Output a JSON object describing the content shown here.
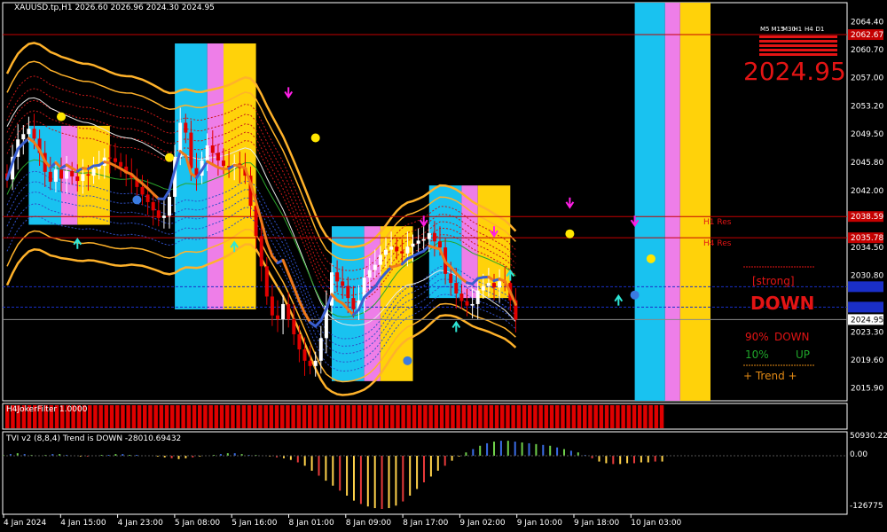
{
  "header": {
    "title": "XAUUSD.tp,H1  2026.60 2026.96 2024.30 2024.95"
  },
  "panels": {
    "filter_label": "H4JokerFilter 1.0000",
    "tvi_label": "TVI v2 (8,8,4) Trend is DOWN -28010.69432"
  },
  "price_panel": {
    "ylim": [
      2014.2,
      2066.9
    ],
    "ticks": [
      {
        "value": 2064.4,
        "label": "2064.40"
      },
      {
        "value": 2060.7,
        "label": "2060.70"
      },
      {
        "value": 2057.0,
        "label": "2057.00"
      },
      {
        "value": 2053.2,
        "label": "2053.20"
      },
      {
        "value": 2049.5,
        "label": "2049.50"
      },
      {
        "value": 2045.8,
        "label": "2045.80"
      },
      {
        "value": 2042.0,
        "label": "2042.00"
      },
      {
        "value": 2034.5,
        "label": "2034.50"
      },
      {
        "value": 2030.8,
        "label": "2030.80"
      },
      {
        "value": 2023.3,
        "label": "2023.30"
      },
      {
        "value": 2019.6,
        "label": "2019.60"
      },
      {
        "value": 2015.9,
        "label": "2015.90"
      }
    ],
    "price_boxes": [
      {
        "value": 2062.67,
        "label": "2062.67",
        "color": "#c40000"
      },
      {
        "value": 2038.59,
        "label": "2038.59",
        "color": "#c40000"
      },
      {
        "value": 2035.78,
        "label": "2035.78",
        "color": "#c40000"
      },
      {
        "value": 2029.3,
        "label": "",
        "color": "#1a2fc8"
      },
      {
        "value": 2026.6,
        "label": "",
        "color": "#1a2fc8"
      },
      {
        "value": 2024.95,
        "label": "2024.95",
        "color": "#ffffff"
      }
    ],
    "res_lines": [
      {
        "value": 2038.59,
        "label": "H1 Res"
      },
      {
        "value": 2035.78,
        "label": "H4 Res"
      }
    ]
  },
  "widget": {
    "timeframes": [
      "M5",
      "M15",
      "M30",
      "H1",
      "H4",
      "D1"
    ],
    "price": "2024.95",
    "signal_small": "[strong]",
    "signal": "DOWN",
    "down_pct": "90%",
    "down_label": "DOWN",
    "up_pct": "10%",
    "up_label": "UP",
    "trend_label": "+ Trend +"
  },
  "tvi_panel": {
    "ticks": [
      {
        "value": 50930.23,
        "label": "50930.229"
      },
      {
        "value": 0,
        "label": "0.00"
      },
      {
        "value": -126775,
        "label": "-126775"
      }
    ]
  },
  "time_axis": {
    "labels": [
      "4 Jan 2024",
      "4 Jan 15:00",
      "4 Jan 23:00",
      "5 Jan 08:00",
      "5 Jan 16:00",
      "8 Jan 01:00",
      "8 Jan 09:00",
      "8 Jan 17:00",
      "9 Jan 02:00",
      "9 Jan 10:00",
      "9 Jan 18:00",
      "10 Jan 03:00"
    ]
  },
  "colors": {
    "background": "#000000",
    "bull_candle": "#ffffff",
    "bear_candle": "#e00000",
    "zone_cyan": "#19c2f0",
    "zone_magenta": "#ee7ee8",
    "zone_yellow": "#ffd20a",
    "trend_blue": "#3a5fd0",
    "trend_orange": "#f07a1a",
    "band_orange": "#ffb22a"
  },
  "chart_data": {
    "type": "candlestick",
    "symbol": "XAUUSD.tp",
    "timeframe": "H1",
    "last": {
      "open": 2026.6,
      "high": 2026.96,
      "low": 2024.3,
      "close": 2024.95
    },
    "close_series": [
      2043.5,
      2046.5,
      2048.8,
      2049.5,
      2050.2,
      2048.9,
      2047.0,
      2044.5,
      2043.2,
      2044.8,
      2043.6,
      2044.6,
      2043.9,
      2043.3,
      2044.2,
      2044.0,
      2044.9,
      2045.3,
      2046.4,
      2046.3,
      2045.8,
      2045.2,
      2044.3,
      2043.7,
      2042.5,
      2041.5,
      2040.5,
      2039.4,
      2038.4,
      2038.7,
      2041.2,
      2046.5,
      2051.0,
      2049.7,
      2045.0,
      2044.0,
      2046.0,
      2048.0,
      2047.0,
      2046.0,
      2045.3,
      2045.1,
      2045.6,
      2045.0,
      2044.0,
      2040.0,
      2036.0,
      2032.0,
      2028.0,
      2025.5,
      2025.0,
      2027.0,
      2025.0,
      2023.0,
      2021.0,
      2019.5,
      2018.8,
      2019.5,
      2022.5,
      2026.8,
      2031.2,
      2030.0,
      2029.4,
      2027.8,
      2026.3,
      2027.5,
      2030.5,
      2031.5,
      2032.2,
      2033.5,
      2034.2,
      2034.6,
      2034.0,
      2033.7,
      2034.6,
      2035.0,
      2035.4,
      2035.6,
      2036.4,
      2035.3,
      2034.5,
      2031.0,
      2029.8,
      2028.4,
      2027.4,
      2026.8,
      2027.0,
      2028.8,
      2029.4,
      2029.8,
      2029.2,
      2030.0,
      2029.8,
      2027.5,
      2024.95
    ],
    "zones": [
      {
        "start": 4,
        "end": 19,
        "top": 2050.6,
        "bottom": 2037.5
      },
      {
        "start": 31,
        "end": 46,
        "top": 2061.5,
        "bottom": 2026.3
      },
      {
        "start": 60,
        "end": 75,
        "top": 2037.3,
        "bottom": 2016.8
      },
      {
        "start": 78,
        "end": 93,
        "top": 2042.7,
        "bottom": 2027.8
      },
      {
        "start": 116,
        "end": 130,
        "top": 2066.9,
        "bottom": 2014.2
      }
    ],
    "filter_hist_count": 120,
    "tvi_hist": [
      1,
      2,
      3,
      2,
      1,
      0,
      1,
      2,
      2,
      1,
      0,
      -1,
      -1,
      0,
      1,
      1,
      2,
      2,
      1,
      1,
      0,
      0,
      -1,
      -2,
      -3,
      -4,
      -3,
      -2,
      -1,
      0,
      1,
      2,
      3,
      3,
      2,
      1,
      1,
      0,
      -1,
      -2,
      -3,
      -5,
      -8,
      -12,
      -18,
      -24,
      -30,
      -36,
      -42,
      -48,
      -54,
      -58,
      -61,
      -63,
      -64,
      -63,
      -60,
      -55,
      -48,
      -40,
      -32,
      -25,
      -18,
      -12,
      -6,
      -1,
      4,
      8,
      12,
      15,
      17,
      18,
      18,
      17,
      16,
      15,
      14,
      13,
      12,
      10,
      8,
      6,
      4,
      1,
      -3,
      -7,
      -9,
      -10,
      -10,
      -9,
      -9,
      -8,
      -8,
      -7,
      -7
    ]
  }
}
